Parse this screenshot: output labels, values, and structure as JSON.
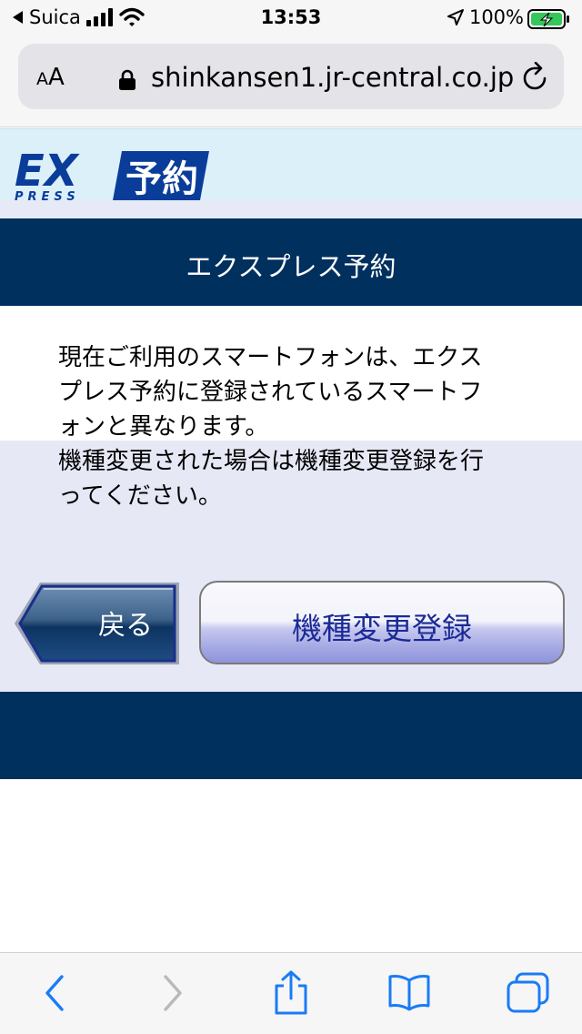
{
  "status_bar": {
    "carrier": "Suica",
    "time": "13:53",
    "battery": "100%"
  },
  "browser": {
    "aa_small": "A",
    "aa_big": "A",
    "url": "shinkansen1.jr-central.co.jp"
  },
  "logo": {
    "ex": "EX",
    "press": "PRESS",
    "kanji": "予約"
  },
  "header": {
    "title": "エクスプレス予約"
  },
  "message": {
    "line1": "現在ご利用のスマートフォンは、エクス",
    "line2": "プレス予約に登録されているスマートフ",
    "line3": "ォンと異なります。",
    "line4": "機種変更された場合は機種変更登録を行",
    "line5": "ってください。"
  },
  "buttons": {
    "back": "戻る",
    "change_registration": "機種変更登録"
  },
  "colors": {
    "navy": "#00305e",
    "lavender": "#e7e8f6",
    "logo_blue": "#0a3d9a",
    "link_blue": "#1a7cf5"
  }
}
